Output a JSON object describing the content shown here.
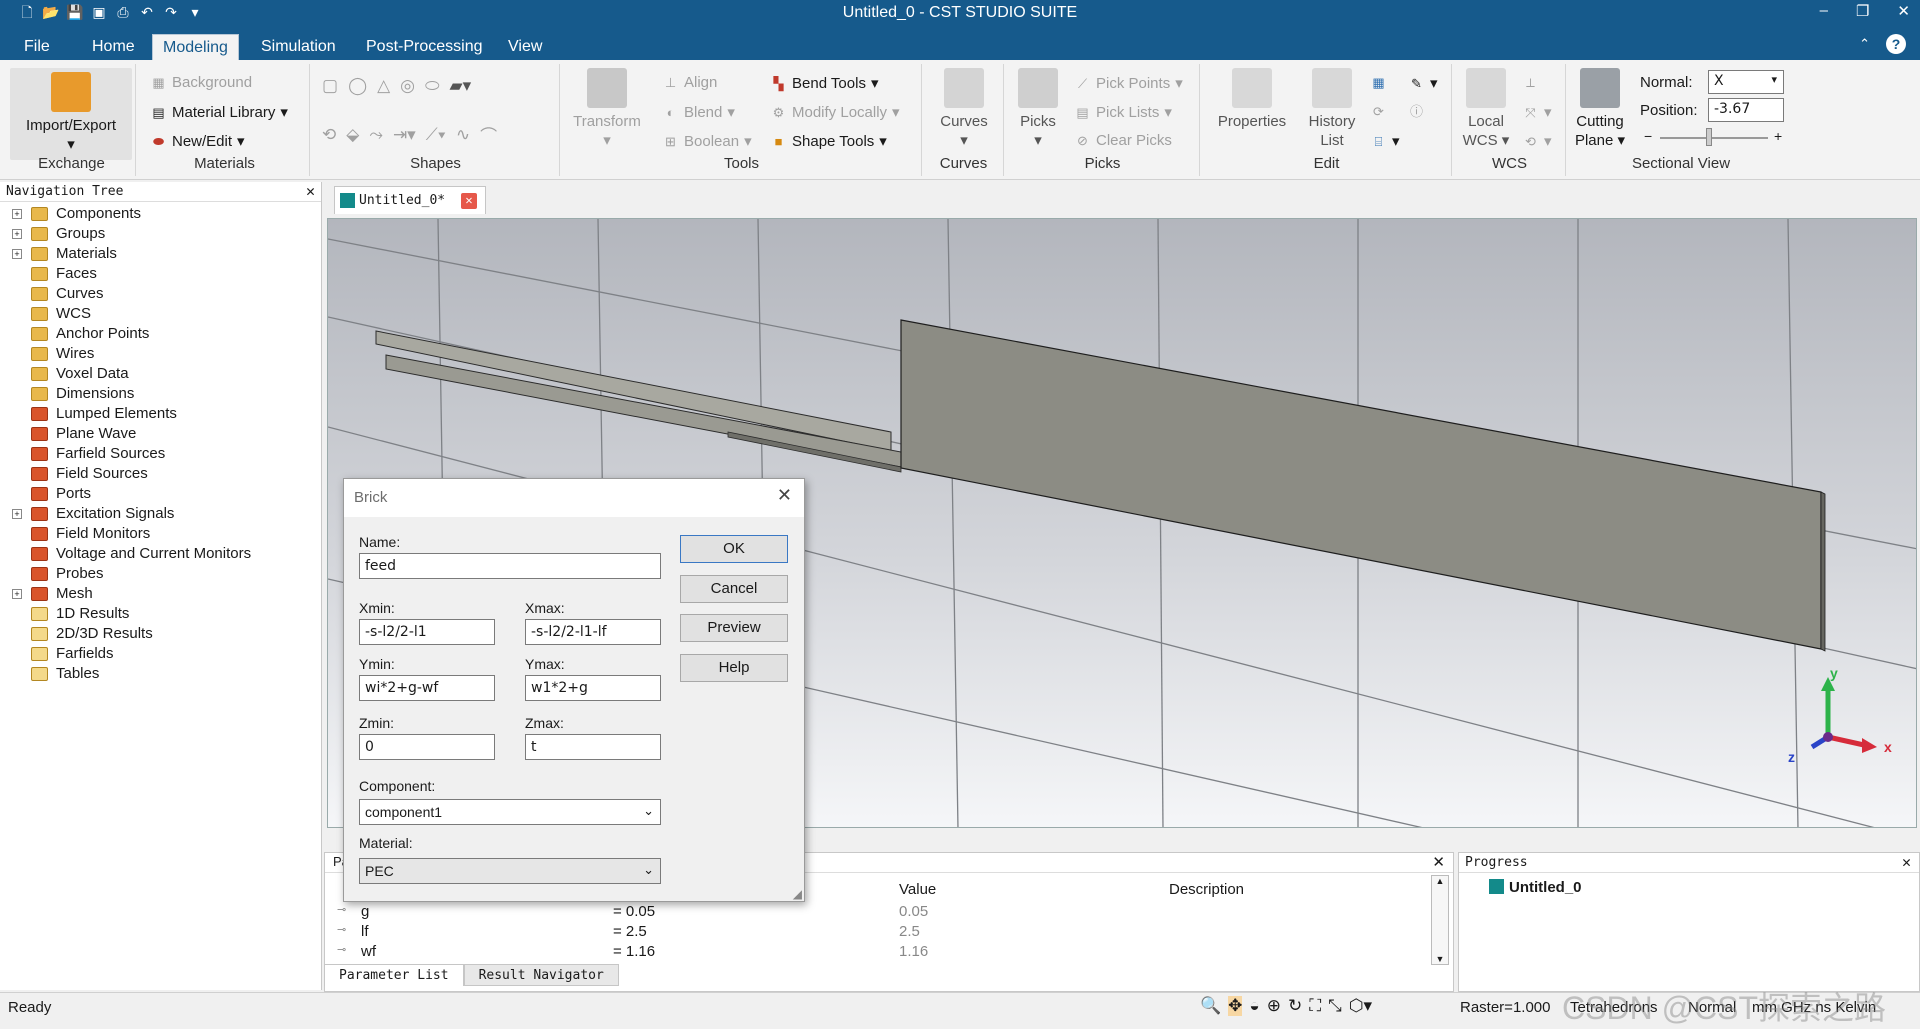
{
  "window": {
    "title": "Untitled_0 - CST STUDIO SUITE",
    "help": "?"
  },
  "tabs": [
    "File",
    "Home",
    "Modeling",
    "Simulation",
    "Post-Processing",
    "View"
  ],
  "ribbon": {
    "exchange": {
      "label": "Exchange",
      "import_export": "Import/Export"
    },
    "materials": {
      "label": "Materials",
      "background": "Background",
      "material_library": "Material Library",
      "new_edit": "New/Edit"
    },
    "shapes": {
      "label": "Shapes"
    },
    "tools": {
      "label": "Tools",
      "transform": "Transform",
      "align": "Align",
      "blend": "Blend",
      "boolean": "Boolean",
      "bend_tools": "Bend Tools",
      "modify_locally": "Modify Locally",
      "shape_tools": "Shape Tools"
    },
    "curves": {
      "label": "Curves",
      "curves": "Curves"
    },
    "picks": {
      "label": "Picks",
      "picks": "Picks",
      "pick_points": "Pick Points",
      "pick_lists": "Pick Lists",
      "clear_picks": "Clear Picks"
    },
    "edit": {
      "label": "Edit",
      "properties": "Properties",
      "history_list_1": "History",
      "history_list_2": "List"
    },
    "wcs": {
      "label": "WCS",
      "local_wcs_1": "Local",
      "local_wcs_2": "WCS"
    },
    "sectional": {
      "label": "Sectional View",
      "cutting_plane_1": "Cutting",
      "cutting_plane_2": "Plane",
      "normal_label": "Normal:",
      "normal_value": "X",
      "position_label": "Position:",
      "position_value": "-3.67",
      "minus": "−",
      "plus": "+"
    }
  },
  "nav": {
    "title": "Navigation Tree",
    "items": [
      "Components",
      "Groups",
      "Materials",
      "Faces",
      "Curves",
      "WCS",
      "Anchor Points",
      "Wires",
      "Voxel Data",
      "Dimensions",
      "Lumped Elements",
      "Plane Wave",
      "Farfield Sources",
      "Field Sources",
      "Ports",
      "Excitation Signals",
      "Field Monitors",
      "Voltage and Current Monitors",
      "Probes",
      "Mesh",
      "1D Results",
      "2D/3D Results",
      "Farfields",
      "Tables"
    ]
  },
  "doc_tab": "Untitled_0*",
  "dialog": {
    "title": "Brick",
    "name_label": "Name:",
    "name": "feed",
    "xmin_label": "Xmin:",
    "xmin": "-s-l2/2-l1",
    "xmax_label": "Xmax:",
    "xmax": "-s-l2/2-l1-lf",
    "ymin_label": "Ymin:",
    "ymin": "wi*2+g-wf",
    "ymax_label": "Ymax:",
    "ymax": "w1*2+g",
    "zmin_label": "Zmin:",
    "zmin": "0",
    "zmax_label": "Zmax:",
    "zmax": "t",
    "component_label": "Component:",
    "component": "component1",
    "material_label": "Material:",
    "material": "PEC",
    "ok": "OK",
    "cancel": "Cancel",
    "preview": "Preview",
    "help": "Help"
  },
  "params": {
    "header_fragment": "Pa",
    "columns": {
      "value": "Value",
      "description": "Description"
    },
    "rows": [
      {
        "name": "g",
        "expr": "= 0.05",
        "value": "0.05"
      },
      {
        "name": "lf",
        "expr": "= 2.5",
        "value": "2.5"
      },
      {
        "name": "wf",
        "expr": "= 1.16",
        "value": "1.16"
      }
    ]
  },
  "bottom_tabs": [
    "Parameter List",
    "Result Navigator"
  ],
  "progress": {
    "title": "Progress",
    "item": "Untitled_0"
  },
  "axes": {
    "x": "x",
    "y": "y",
    "z": "z"
  },
  "status": {
    "ready": "Ready",
    "raster": "Raster=1.000",
    "mesh": "Tetrahedrons",
    "mode": "Normal",
    "units": "mm GHz ns Kelvin",
    "watermark": "CSDN @CST探索之路"
  },
  "colors": {
    "title_bar": "#165a8c",
    "ribbon": "#f3f3f3",
    "model": "#8c8c84"
  }
}
